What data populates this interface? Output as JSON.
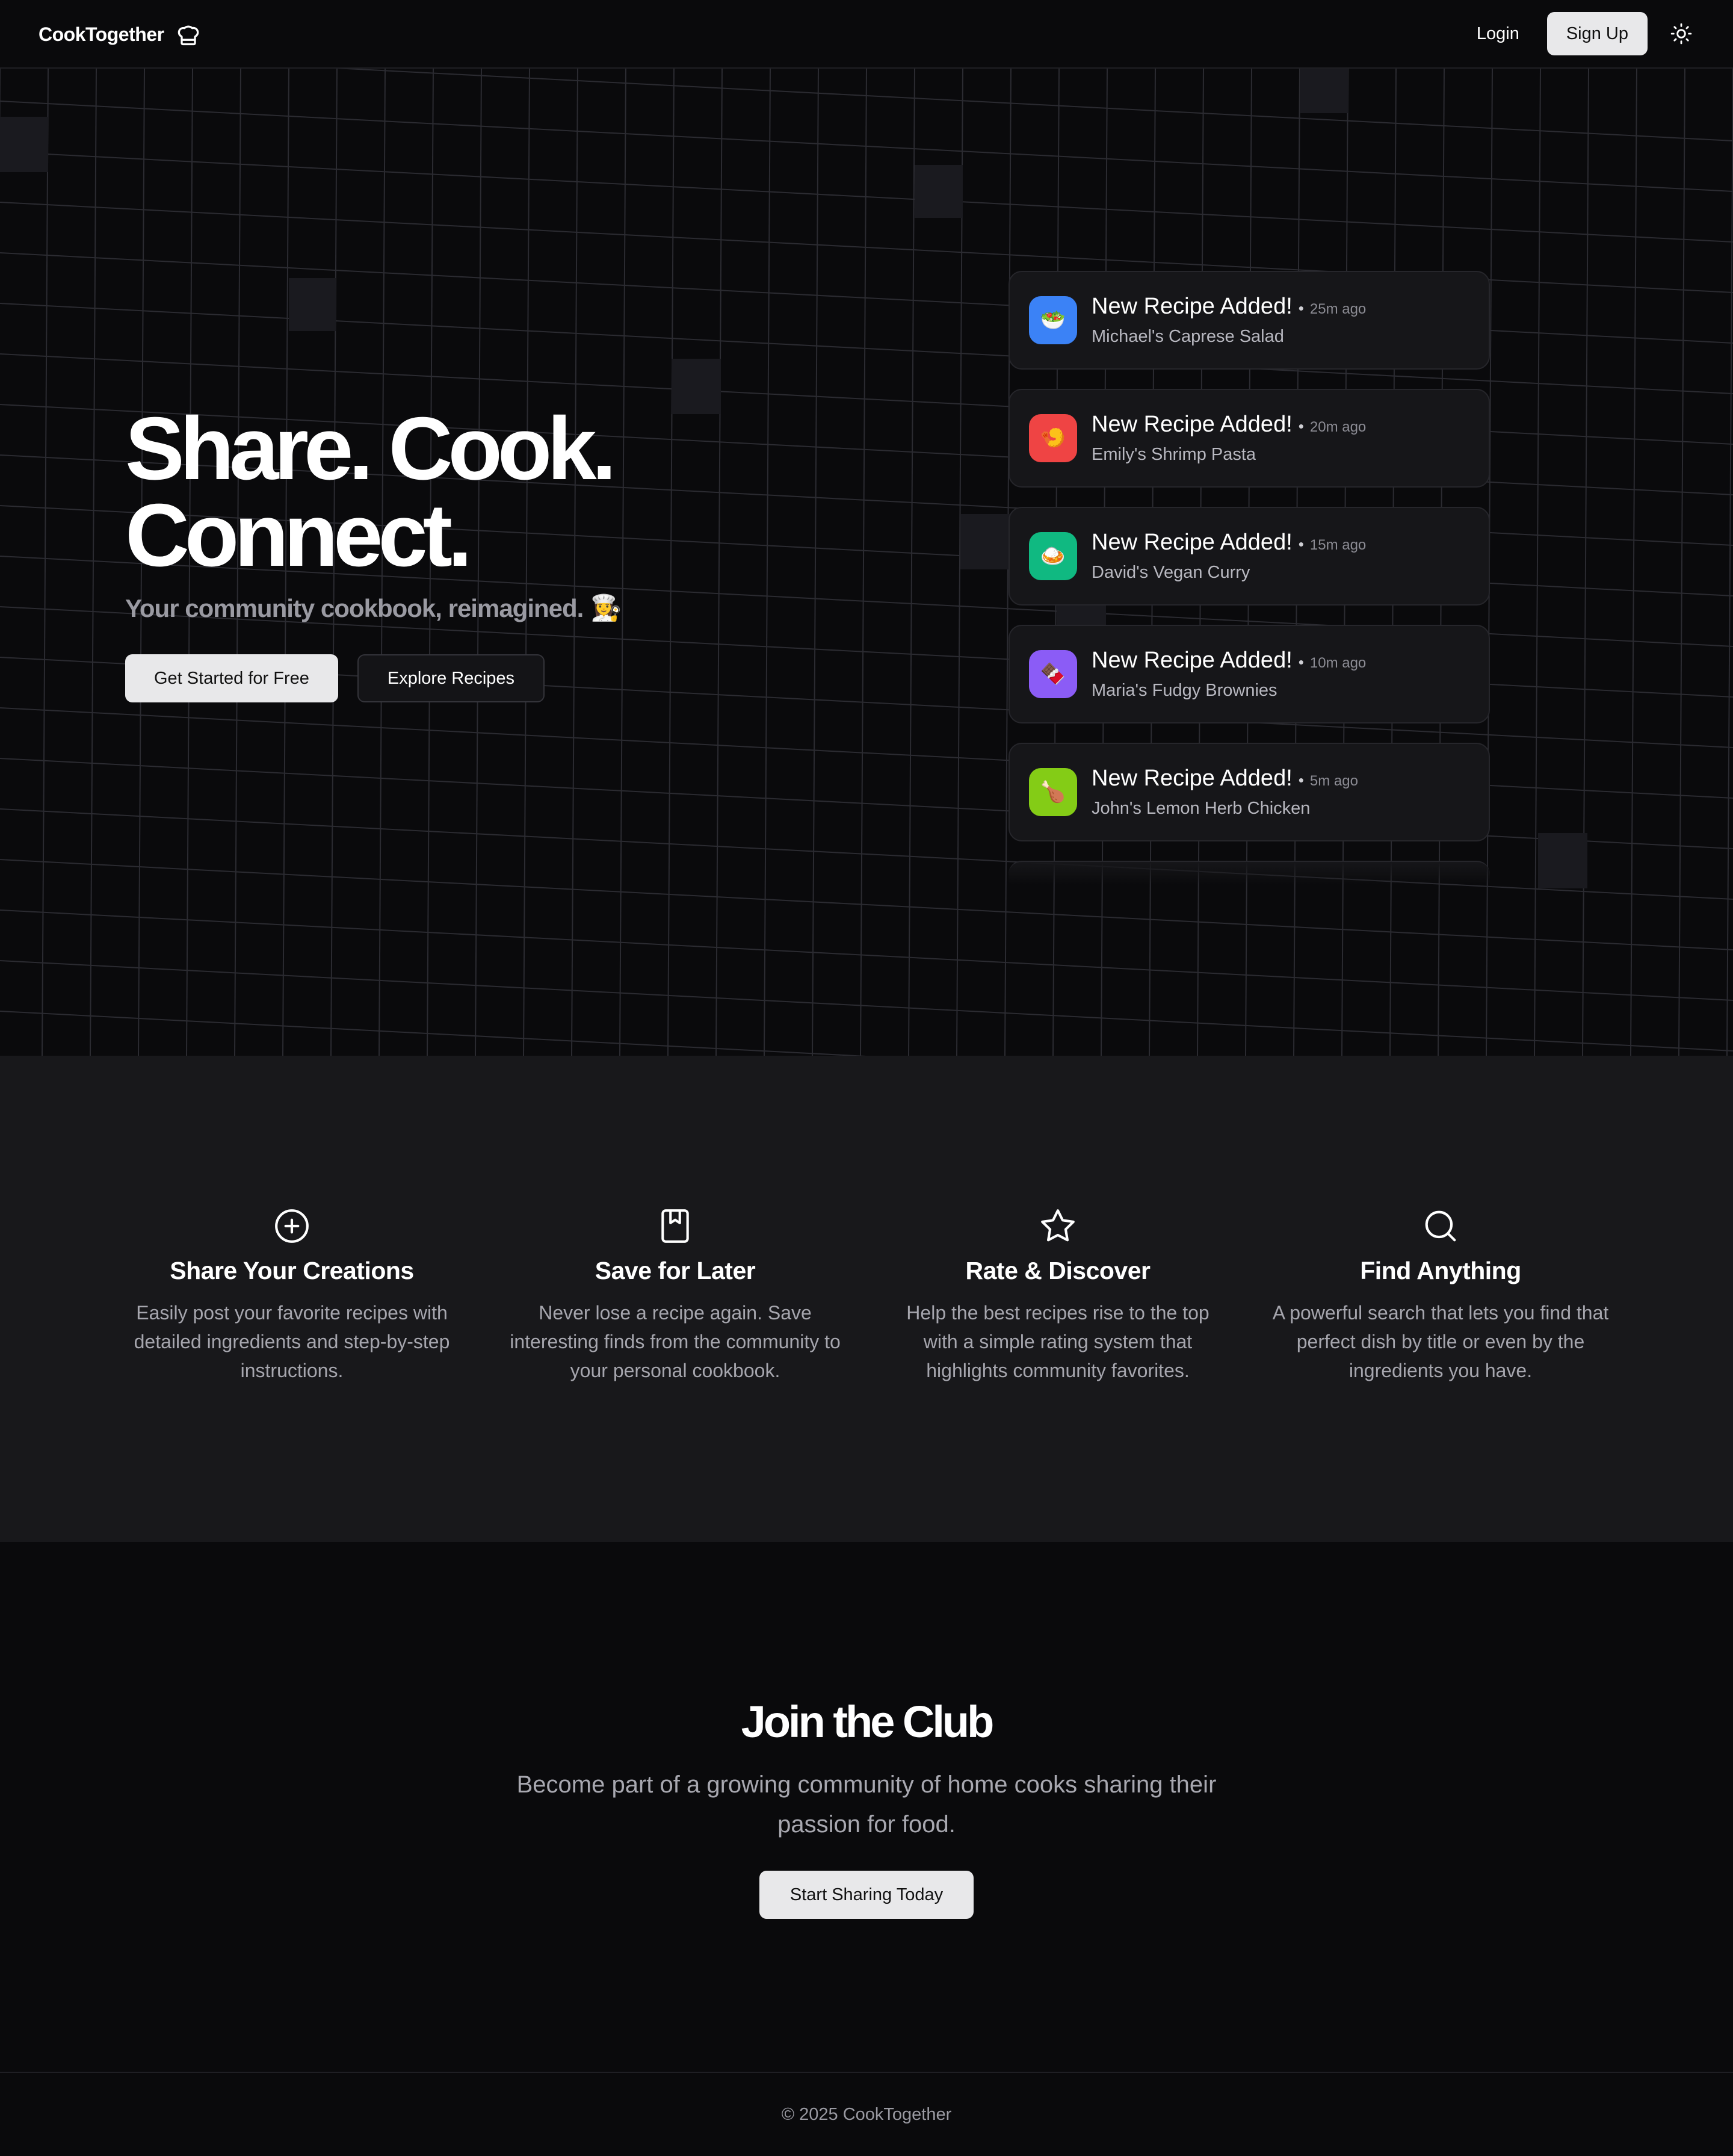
{
  "nav": {
    "brand": "CookTogether",
    "brand_icon": "chef-hat-icon",
    "login_label": "Login",
    "signup_label": "Sign Up",
    "theme_icon": "sun-icon"
  },
  "hero": {
    "title_line1": "Share. Cook.",
    "title_line2": "Connect.",
    "subtitle": "Your community cookbook, reimagined.",
    "subtitle_emoji": "👩‍🍳",
    "primary_button": "Get Started for Free",
    "secondary_button": "Explore Recipes"
  },
  "feed": [
    {
      "title": "New Recipe Added!",
      "separator": "•",
      "time": "25m ago",
      "name": "Michael's Caprese Salad",
      "emoji": "🥗",
      "color": "#3b82f6"
    },
    {
      "title": "New Recipe Added!",
      "separator": "•",
      "time": "20m ago",
      "name": "Emily's Shrimp Pasta",
      "emoji": "🍤",
      "color": "#ef4444"
    },
    {
      "title": "New Recipe Added!",
      "separator": "•",
      "time": "15m ago",
      "name": "David's Vegan Curry",
      "emoji": "🍛",
      "color": "#10b981"
    },
    {
      "title": "New Recipe Added!",
      "separator": "•",
      "time": "10m ago",
      "name": "Maria's Fudgy Brownies",
      "emoji": "🍫",
      "color": "#8b5cf6"
    },
    {
      "title": "New Recipe Added!",
      "separator": "•",
      "time": "5m ago",
      "name": "John's Lemon Herb Chicken",
      "emoji": "🍗",
      "color": "#84cc16"
    }
  ],
  "features": [
    {
      "icon": "plus-circle-icon",
      "title": "Share Your Creations",
      "desc": "Easily post your favorite recipes with detailed ingredients and step-by-step instructions."
    },
    {
      "icon": "bookmark-icon",
      "title": "Save for Later",
      "desc": "Never lose a recipe again. Save interesting finds from the community to your personal cookbook."
    },
    {
      "icon": "star-icon",
      "title": "Rate & Discover",
      "desc": "Help the best recipes rise to the top with a simple rating system that highlights community favorites."
    },
    {
      "icon": "search-icon",
      "title": "Find Anything",
      "desc": "A powerful search that lets you find that perfect dish by title or even by the ingredients you have."
    }
  ],
  "cta": {
    "title": "Join the Club",
    "text": "Become part of a growing community of home cooks sharing their passion for food.",
    "button": "Start Sharing Today"
  },
  "footer": {
    "text": "© 2025 CookTogether"
  }
}
